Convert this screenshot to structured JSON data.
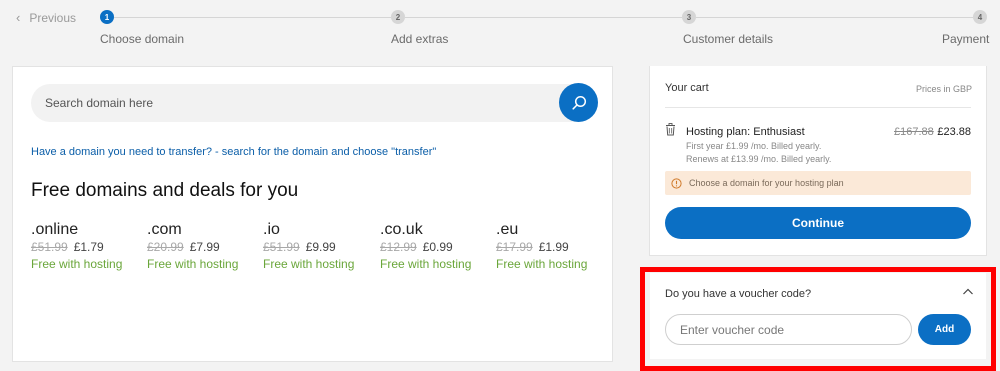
{
  "stepper": {
    "previous_label": "Previous",
    "steps": [
      {
        "number": "1",
        "label": "Choose domain",
        "active": true
      },
      {
        "number": "2",
        "label": "Add extras",
        "active": false
      },
      {
        "number": "3",
        "label": "Customer details",
        "active": false
      },
      {
        "number": "4",
        "label": "Payment",
        "active": false
      }
    ]
  },
  "search": {
    "placeholder": "Search domain here",
    "value": ""
  },
  "transfer_link": "Have a domain you need to transfer? - search for the domain and choose \"transfer\"",
  "deals": {
    "title": "Free domains and deals for you",
    "domains": [
      {
        "tld": ".online",
        "old_price": "£51.99",
        "new_price": "£1.79",
        "note": "Free with hosting"
      },
      {
        "tld": ".com",
        "old_price": "£20.99",
        "new_price": "£7.99",
        "note": "Free with hosting"
      },
      {
        "tld": ".io",
        "old_price": "£51.99",
        "new_price": "£9.99",
        "note": "Free with hosting"
      },
      {
        "tld": ".co.uk",
        "old_price": "£12.99",
        "new_price": "£0.99",
        "note": "Free with hosting"
      },
      {
        "tld": ".eu",
        "old_price": "£17.99",
        "new_price": "£1.99",
        "note": "Free with hosting"
      }
    ]
  },
  "cart": {
    "title": "Your cart",
    "currency_note": "Prices in GBP",
    "item": {
      "name": "Hosting plan: Enthusiast",
      "old_price": "£167.88",
      "new_price": "£23.88",
      "line1": "First year £1.99 /mo. Billed yearly.",
      "line2": "Renews at £13.99 /mo. Billed yearly."
    },
    "warning": "Choose a domain for your hosting plan",
    "continue_label": "Continue"
  },
  "voucher": {
    "question": "Do you have a voucher code?",
    "placeholder": "Enter voucher code",
    "value": "",
    "add_label": "Add"
  },
  "colors": {
    "accent": "#0b6fc4",
    "success": "#6aa63a",
    "warning_bg": "#fbe9d8",
    "highlight": "#ff0000"
  }
}
